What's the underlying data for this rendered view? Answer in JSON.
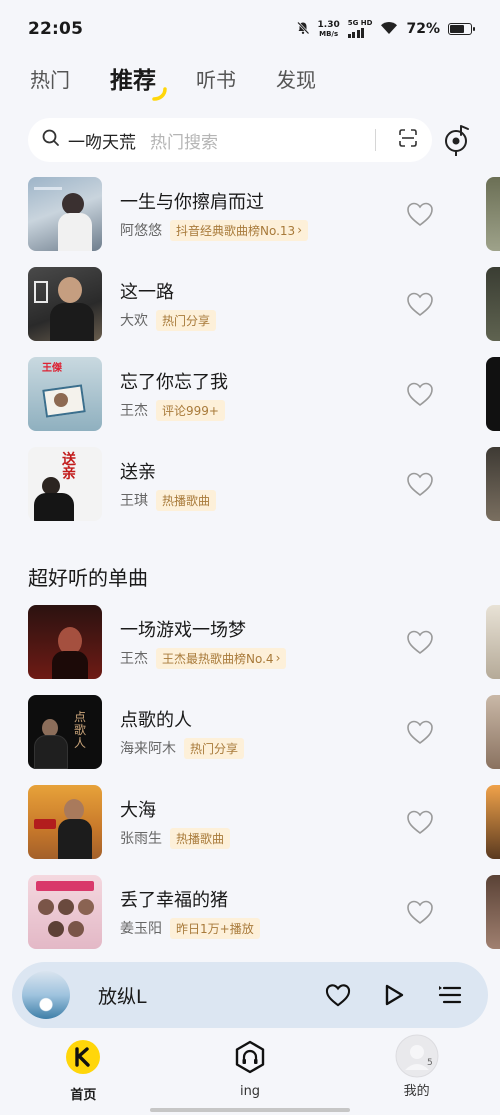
{
  "status_bar": {
    "time": "22:05",
    "net_speed_value": "1.30",
    "net_speed_unit": "MB/s",
    "network_label": "5G HD",
    "battery_percent": "72%",
    "battery_level": 0.72
  },
  "top_tabs": [
    {
      "label": "热门",
      "active": false
    },
    {
      "label": "推荐",
      "active": true
    },
    {
      "label": "听书",
      "active": false
    },
    {
      "label": "发现",
      "active": false
    }
  ],
  "search": {
    "query": "一吻天荒",
    "hint": "热门搜索",
    "icon": "search-icon",
    "scan_icon": "scan-icon",
    "voice_icon": "music-voice-icon"
  },
  "recommend_list": [
    {
      "title": "一生与你擦肩而过",
      "artist": "阿悠悠",
      "tag": "抖音经典歌曲榜No.13",
      "tag_has_arrow": true
    },
    {
      "title": "这一路",
      "artist": "大欢",
      "tag": "热门分享",
      "tag_has_arrow": false
    },
    {
      "title": "忘了你忘了我",
      "artist": "王杰",
      "tag": "评论999+",
      "tag_has_arrow": false
    },
    {
      "title": "送亲",
      "artist": "王琪",
      "tag": "热播歌曲",
      "tag_has_arrow": false
    }
  ],
  "section": {
    "title": "超好听的单曲"
  },
  "singles_list": [
    {
      "title": "一场游戏一场梦",
      "artist": "王杰",
      "tag": "王杰最热歌曲榜No.4",
      "tag_has_arrow": true
    },
    {
      "title": "点歌的人",
      "artist": "海来阿木",
      "tag": "热门分享",
      "tag_has_arrow": false
    },
    {
      "title": "大海",
      "artist": "张雨生",
      "tag": "热播歌曲",
      "tag_has_arrow": false
    },
    {
      "title": "丢了幸福的猪",
      "artist": "姜玉阳",
      "tag": "昨日1万+播放",
      "tag_has_arrow": false
    }
  ],
  "mini_player": {
    "title": "放纵L",
    "icons": [
      "heart-icon",
      "play-icon",
      "playlist-icon"
    ]
  },
  "bottom_nav": [
    {
      "label": "首页",
      "icon": "home-k-icon",
      "active": true
    },
    {
      "label": "ing",
      "icon": "headphone-icon",
      "active": false
    },
    {
      "label": "我的",
      "icon": "avatar-icon",
      "active": false,
      "badge": "5"
    }
  ],
  "colors": {
    "background": "#f5f6fa",
    "accent_yellow": "#ffd60a",
    "tag_bg": "#fdf0d9",
    "tag_text": "#a87a3a",
    "player_bg": "#dce6f2"
  }
}
